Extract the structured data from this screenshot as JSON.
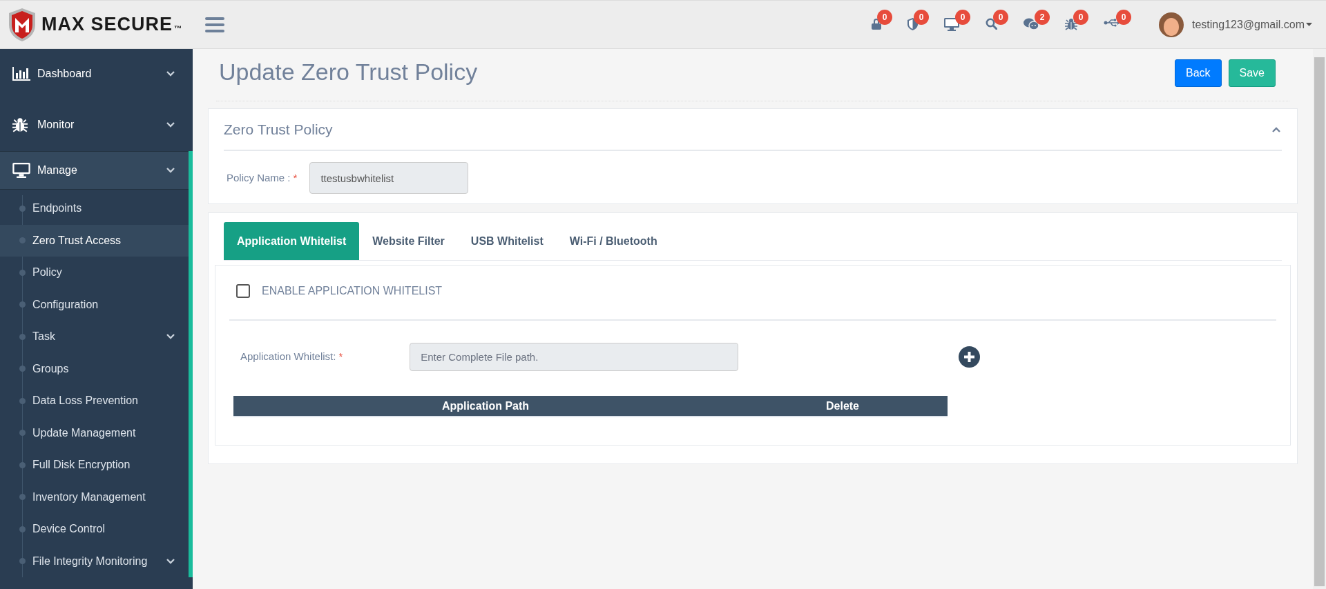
{
  "header": {
    "logo": {
      "text": "MAX SECURE",
      "mark": "™"
    },
    "notifications": [
      {
        "kind": "lock",
        "count": "0"
      },
      {
        "kind": "shield",
        "count": "0"
      },
      {
        "kind": "monitor",
        "count": "0"
      },
      {
        "kind": "search",
        "count": "0"
      },
      {
        "kind": "chat",
        "count": "2"
      },
      {
        "kind": "bug",
        "count": "0"
      },
      {
        "kind": "usb",
        "count": "0"
      }
    ],
    "user": {
      "email": "testing123@gmail.com"
    }
  },
  "sidebar": {
    "items": [
      {
        "label": "Dashboard",
        "kind": "chart",
        "expanded": false
      },
      {
        "label": "Monitor",
        "kind": "bug",
        "expanded": false
      },
      {
        "label": "Manage",
        "kind": "monitor",
        "expanded": true,
        "children": [
          {
            "label": "Endpoints",
            "selected": false,
            "expandable": false
          },
          {
            "label": "Zero Trust Access",
            "selected": true,
            "expandable": false
          },
          {
            "label": "Policy",
            "selected": false,
            "expandable": false
          },
          {
            "label": "Configuration",
            "selected": false,
            "expandable": false
          },
          {
            "label": "Task",
            "selected": false,
            "expandable": true
          },
          {
            "label": "Groups",
            "selected": false,
            "expandable": false
          },
          {
            "label": "Data Loss Prevention",
            "selected": false,
            "expandable": false
          },
          {
            "label": "Update Management",
            "selected": false,
            "expandable": false
          },
          {
            "label": "Full Disk Encryption",
            "selected": false,
            "expandable": false
          },
          {
            "label": "Inventory Management",
            "selected": false,
            "expandable": false
          },
          {
            "label": "Device Control",
            "selected": false,
            "expandable": false
          },
          {
            "label": "File Integrity Monitoring",
            "selected": false,
            "expandable": true
          }
        ]
      }
    ]
  },
  "page": {
    "title": "Update Zero Trust Policy",
    "buttons": [
      {
        "label": "Back",
        "kind": "back"
      },
      {
        "label": "Save",
        "kind": "save"
      }
    ],
    "policy_card": {
      "title": "Zero Trust Policy",
      "expanded": true,
      "field": {
        "label": "Policy Name :",
        "required_mark": "*",
        "value": "ttestusbwhitelist"
      }
    },
    "tabs": [
      {
        "label": "Application Whitelist",
        "selected": true
      },
      {
        "label": "Website Filter",
        "selected": false
      },
      {
        "label": "USB Whitelist",
        "selected": false
      },
      {
        "label": "Wi-Fi / Bluetooth",
        "selected": false
      }
    ],
    "panel": {
      "checkbox": {
        "label": "ENABLE APPLICATION WHITELIST",
        "checked": false
      },
      "field": {
        "label": "Application Whitelist:",
        "required_mark": "*",
        "placeholder": "Enter Complete File path."
      },
      "table": {
        "columns": [
          "Application Path",
          "Delete"
        ]
      }
    }
  }
}
